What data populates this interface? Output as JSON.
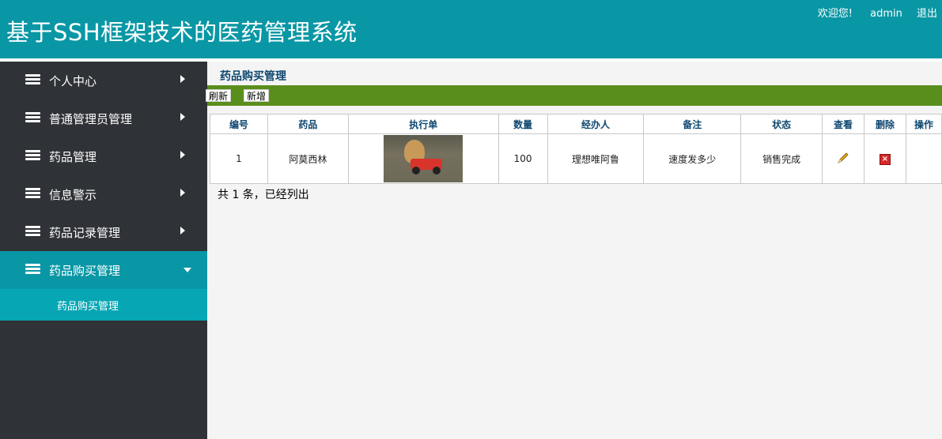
{
  "header": {
    "title": "基于SSH框架技术的医药管理系统",
    "welcome": "欢迎您!",
    "username": "admin",
    "logout": "退出",
    "bg_color": "#0a97a5"
  },
  "sidebar": {
    "items": [
      {
        "label": "个人中心",
        "icon": "stack-icon"
      },
      {
        "label": "普通管理员管理",
        "icon": "stack-icon"
      },
      {
        "label": "药品管理",
        "icon": "stack-icon"
      },
      {
        "label": "信息警示",
        "icon": "stack-icon"
      },
      {
        "label": "药品记录管理",
        "icon": "stack-icon"
      },
      {
        "label": "药品购买管理",
        "icon": "stack-icon",
        "active": true
      }
    ],
    "submenu": {
      "label": "药品购买管理"
    }
  },
  "main": {
    "page_title": "药品购买管理",
    "toolbar": {
      "refresh_label": "刷新",
      "add_label": "新增",
      "bg_color": "#5a8e1c"
    },
    "table": {
      "columns": [
        "编号",
        "药品",
        "执行单",
        "数量",
        "经办人",
        "备注",
        "状态",
        "查看",
        "删除",
        "操作"
      ],
      "rows": [
        {
          "id": "1",
          "drug": "阿莫西林",
          "order_image": "teddy-bear-car-photo",
          "quantity": "100",
          "handler": "理想唯阿鲁",
          "note": "速度发多少",
          "status": "销售完成"
        }
      ]
    },
    "summary": "共 1 条，已经列出"
  }
}
